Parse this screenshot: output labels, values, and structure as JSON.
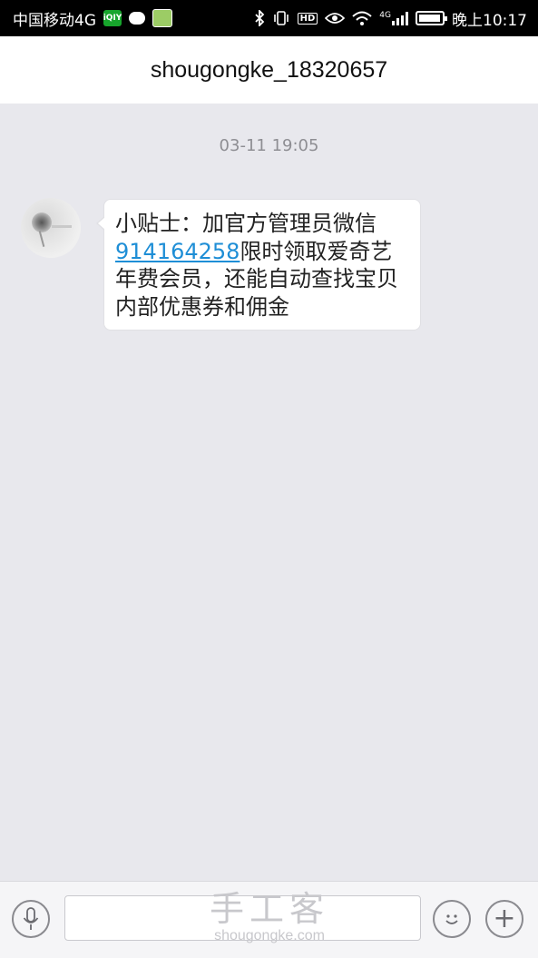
{
  "status_bar": {
    "carrier": "中国移动4G",
    "time": "晚上10:17",
    "hd_label": "HD",
    "network_label": "4G",
    "qiyi_label": "iQIY",
    "icons": [
      "iqiyi-icon",
      "chat-icon",
      "app-icon",
      "bluetooth-icon",
      "vibrate-icon",
      "hd-icon",
      "eye-icon",
      "wifi-icon",
      "signal-icon",
      "battery-icon"
    ]
  },
  "header": {
    "title": "shougongke_18320657"
  },
  "conversation": {
    "timestamp": "03-11 19:05",
    "messages": [
      {
        "sender": "incoming",
        "text_part1": "小贴士：加官方管理员微信",
        "link": "914164258",
        "text_part2": "限时领取爱奇艺年费会员，还能自动查找宝贝内部优惠券和佣金"
      }
    ]
  },
  "input_bar": {
    "text_value": "",
    "plus_label": "+"
  },
  "watermark": {
    "cn": "手工客",
    "en": "shougongke.com"
  }
}
